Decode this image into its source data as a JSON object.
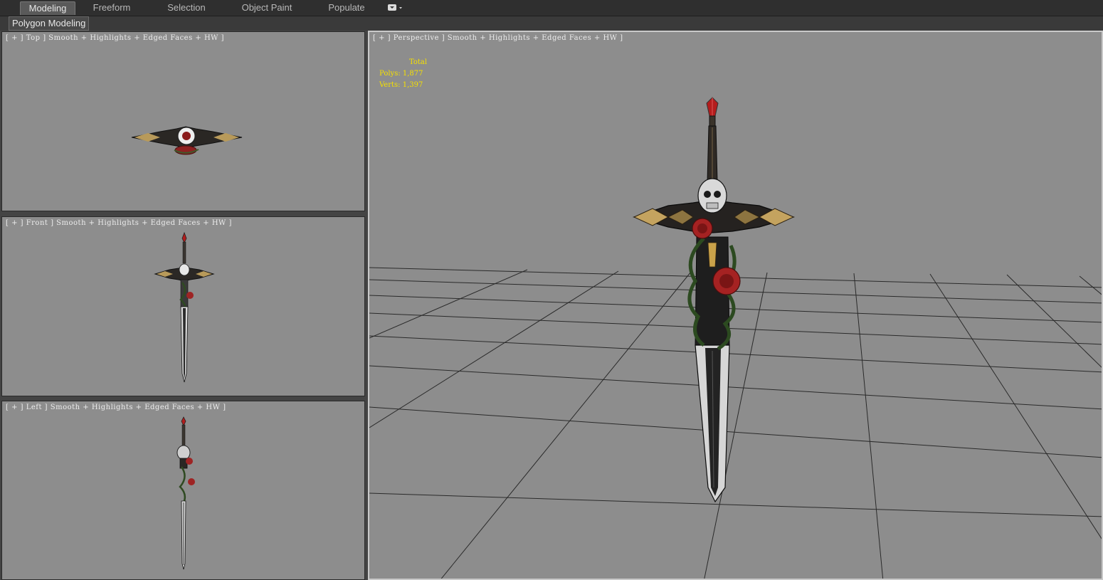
{
  "ribbon": {
    "tabs": [
      {
        "label": "Modeling",
        "active": true
      },
      {
        "label": "Freeform",
        "active": false
      },
      {
        "label": "Selection",
        "active": false
      },
      {
        "label": "Object Paint",
        "active": false
      },
      {
        "label": "Populate",
        "active": false
      }
    ],
    "dropdown_icon": "caret-dropdown-icon"
  },
  "subbar": {
    "tab_label": "Polygon Modeling"
  },
  "viewports": {
    "top": {
      "label": "[ + ] Top ] Smooth + Highlights + Edged Faces + HW ]"
    },
    "front": {
      "label": "[ + ] Front ] Smooth + Highlights + Edged Faces + HW ]"
    },
    "left": {
      "label": "[ + ] Left ] Smooth + Highlights + Edged Faces + HW ]"
    },
    "perspective": {
      "label": "[ + ] Perspective ] Smooth + Highlights + Edged Faces + HW ]"
    }
  },
  "stats": {
    "header": "Total",
    "polys_label": "Polys:",
    "polys_value": "1,877",
    "verts_label": "Verts:",
    "verts_value": "1,397"
  },
  "colors": {
    "viewport_bg": "#8d8d8d",
    "stats_text": "#f5e000",
    "ribbon_bg": "#2f2f2f",
    "grid_line": "#2a2a2a"
  }
}
